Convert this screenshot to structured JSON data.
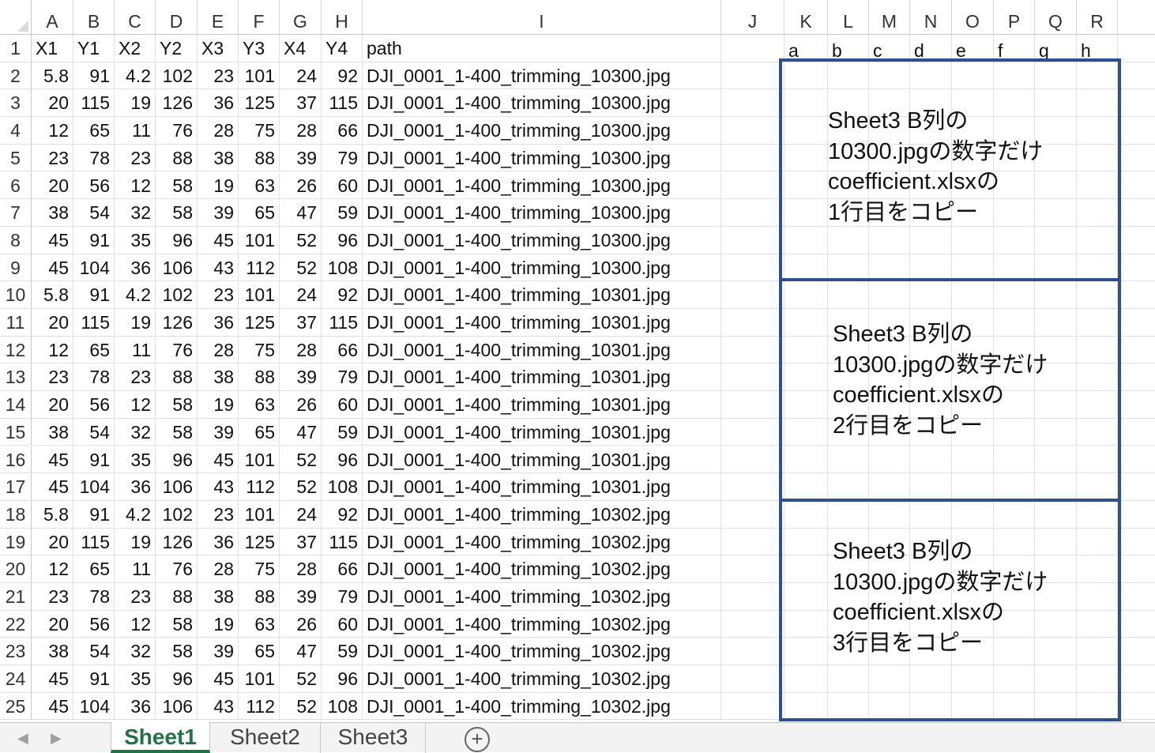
{
  "columns": [
    "A",
    "B",
    "C",
    "D",
    "E",
    "F",
    "G",
    "H",
    "I",
    "J",
    "K",
    "L",
    "M",
    "N",
    "O",
    "P",
    "Q",
    "R"
  ],
  "rows": [
    [
      "X1",
      "Y1",
      "X2",
      "Y2",
      "X3",
      "Y3",
      "X4",
      "Y4",
      "path",
      "",
      "a",
      "b",
      "c",
      "d",
      "e",
      "f",
      "g",
      "h"
    ],
    [
      "5.8",
      "91",
      "4.2",
      "102",
      "23",
      "101",
      "24",
      "92",
      "DJI_0001_1-400_trimming_10300.jpg"
    ],
    [
      "20",
      "115",
      "19",
      "126",
      "36",
      "125",
      "37",
      "115",
      "DJI_0001_1-400_trimming_10300.jpg"
    ],
    [
      "12",
      "65",
      "11",
      "76",
      "28",
      "75",
      "28",
      "66",
      "DJI_0001_1-400_trimming_10300.jpg"
    ],
    [
      "23",
      "78",
      "23",
      "88",
      "38",
      "88",
      "39",
      "79",
      "DJI_0001_1-400_trimming_10300.jpg"
    ],
    [
      "20",
      "56",
      "12",
      "58",
      "19",
      "63",
      "26",
      "60",
      "DJI_0001_1-400_trimming_10300.jpg"
    ],
    [
      "38",
      "54",
      "32",
      "58",
      "39",
      "65",
      "47",
      "59",
      "DJI_0001_1-400_trimming_10300.jpg"
    ],
    [
      "45",
      "91",
      "35",
      "96",
      "45",
      "101",
      "52",
      "96",
      "DJI_0001_1-400_trimming_10300.jpg"
    ],
    [
      "45",
      "104",
      "36",
      "106",
      "43",
      "112",
      "52",
      "108",
      "DJI_0001_1-400_trimming_10300.jpg"
    ],
    [
      "5.8",
      "91",
      "4.2",
      "102",
      "23",
      "101",
      "24",
      "92",
      "DJI_0001_1-400_trimming_10301.jpg"
    ],
    [
      "20",
      "115",
      "19",
      "126",
      "36",
      "125",
      "37",
      "115",
      "DJI_0001_1-400_trimming_10301.jpg"
    ],
    [
      "12",
      "65",
      "11",
      "76",
      "28",
      "75",
      "28",
      "66",
      "DJI_0001_1-400_trimming_10301.jpg"
    ],
    [
      "23",
      "78",
      "23",
      "88",
      "38",
      "88",
      "39",
      "79",
      "DJI_0001_1-400_trimming_10301.jpg"
    ],
    [
      "20",
      "56",
      "12",
      "58",
      "19",
      "63",
      "26",
      "60",
      "DJI_0001_1-400_trimming_10301.jpg"
    ],
    [
      "38",
      "54",
      "32",
      "58",
      "39",
      "65",
      "47",
      "59",
      "DJI_0001_1-400_trimming_10301.jpg"
    ],
    [
      "45",
      "91",
      "35",
      "96",
      "45",
      "101",
      "52",
      "96",
      "DJI_0001_1-400_trimming_10301.jpg"
    ],
    [
      "45",
      "104",
      "36",
      "106",
      "43",
      "112",
      "52",
      "108",
      "DJI_0001_1-400_trimming_10301.jpg"
    ],
    [
      "5.8",
      "91",
      "4.2",
      "102",
      "23",
      "101",
      "24",
      "92",
      "DJI_0001_1-400_trimming_10302.jpg"
    ],
    [
      "20",
      "115",
      "19",
      "126",
      "36",
      "125",
      "37",
      "115",
      "DJI_0001_1-400_trimming_10302.jpg"
    ],
    [
      "12",
      "65",
      "11",
      "76",
      "28",
      "75",
      "28",
      "66",
      "DJI_0001_1-400_trimming_10302.jpg"
    ],
    [
      "23",
      "78",
      "23",
      "88",
      "38",
      "88",
      "39",
      "79",
      "DJI_0001_1-400_trimming_10302.jpg"
    ],
    [
      "20",
      "56",
      "12",
      "58",
      "19",
      "63",
      "26",
      "60",
      "DJI_0001_1-400_trimming_10302.jpg"
    ],
    [
      "38",
      "54",
      "32",
      "58",
      "39",
      "65",
      "47",
      "59",
      "DJI_0001_1-400_trimming_10302.jpg"
    ],
    [
      "45",
      "91",
      "35",
      "96",
      "45",
      "101",
      "52",
      "96",
      "DJI_0001_1-400_trimming_10302.jpg"
    ],
    [
      "45",
      "104",
      "36",
      "106",
      "43",
      "112",
      "52",
      "108",
      "DJI_0001_1-400_trimming_10302.jpg"
    ]
  ],
  "notes": [
    {
      "lines": [
        "Sheet3 B列の",
        "10300.jpgの数字だけ",
        "coefficient.xlsxの",
        "1行目をコピー"
      ]
    },
    {
      "lines": [
        "Sheet3 B列の",
        "10300.jpgの数字だけ",
        "coefficient.xlsxの",
        "2行目をコピー"
      ]
    },
    {
      "lines": [
        "Sheet3 B列の",
        "10300.jpgの数字だけ",
        "coefficient.xlsxの",
        "3行目をコピー"
      ]
    }
  ],
  "sheet_tabs": [
    {
      "label": "Sheet1",
      "active": true
    },
    {
      "label": "Sheet2",
      "active": false
    },
    {
      "label": "Sheet3",
      "active": false
    }
  ],
  "nav": {
    "prev_icon": "◀",
    "next_icon": "▶",
    "add_sheet_icon": "+"
  },
  "colors": {
    "note_border": "#2f4f8f",
    "active_tab": "#217346",
    "gridline": "#e1e1e1"
  }
}
